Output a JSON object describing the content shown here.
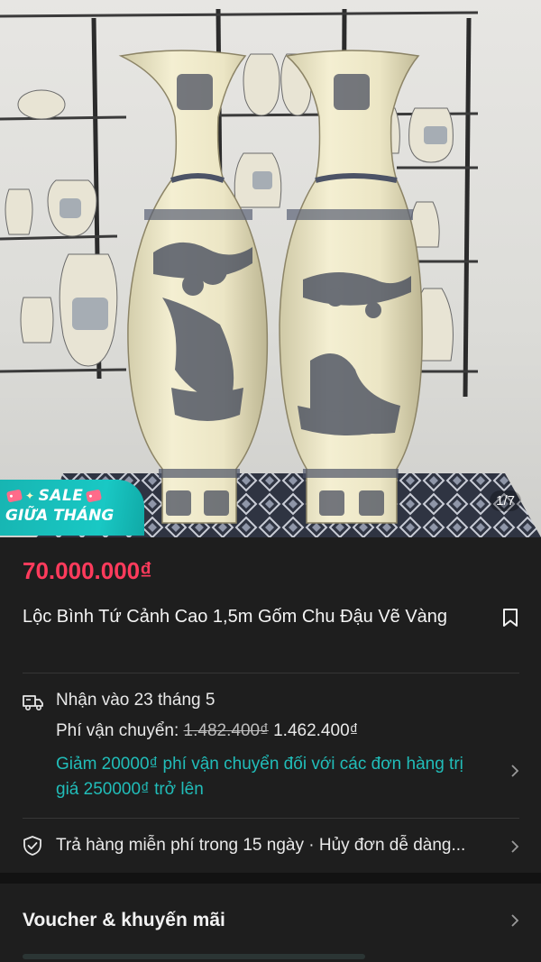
{
  "badge": {
    "line1": "SALE",
    "line2": "GIỮA THÁNG"
  },
  "gallery": {
    "counter": "1/7"
  },
  "product": {
    "price": "70.000.000₫",
    "title": "Lộc Bình Tứ Cảnh Cao 1,5m Gốm Chu Đậu Vẽ Vàng"
  },
  "shipping": {
    "delivery": "Nhận vào 23 tháng 5",
    "fee_label": "Phí vận chuyển: ",
    "fee_old": "1.482.400₫",
    "fee_new": "1.462.400₫",
    "promo": "Giảm 20000₫ phí vận chuyển đối với các đơn hàng trị giá 250000₫ trở lên"
  },
  "returns": {
    "text": "Trả hàng miễn phí trong 15 ngày · Hủy đơn dễ dàng..."
  },
  "voucher": {
    "label": "Voucher & khuyến mãi"
  },
  "colors": {
    "price": "#ff3b5c",
    "promo": "#21bdb9",
    "badge": "#17b5b2",
    "background": "#1e1e1e"
  },
  "icons": [
    "bookmark-icon",
    "truck-icon",
    "shield-check-icon",
    "chevron-right-icon"
  ]
}
